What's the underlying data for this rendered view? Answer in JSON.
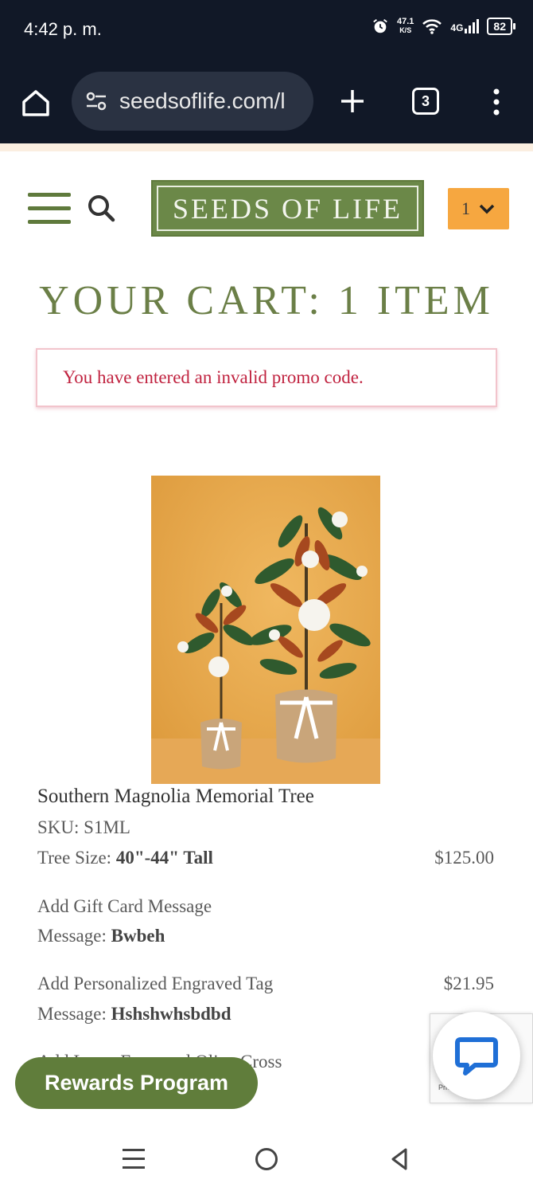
{
  "status_bar": {
    "time": "4:42 p. m.",
    "net_speed_value": "47.1",
    "net_speed_unit": "K/S",
    "network": "4G",
    "battery": "82"
  },
  "browser": {
    "url": "seedsoflife.com/l",
    "tab_count": "3",
    "icons": [
      "home-icon",
      "tune-icon",
      "plus-icon",
      "tabs-icon",
      "more-vert-icon"
    ]
  },
  "header": {
    "logo_text": "SEEDS OF LIFE",
    "cart_count": "1",
    "accent_color": "#6b8848",
    "cart_button_color": "#f6a740"
  },
  "cart": {
    "title": "YOUR CART: 1 ITEM",
    "alert": "You have entered an invalid promo code.",
    "item": {
      "name": "Southern Magnolia Memorial Tree",
      "sku_label": "SKU: ",
      "sku": "S1ML",
      "size_label": "Tree Size: ",
      "size": "40\"-44\" Tall",
      "price": "$125.00",
      "gift_card_label": "Add Gift Card Message",
      "gift_message_label": "Message: ",
      "gift_message": "Bwbeh",
      "engraved_tag_label": "Add Personalized Engraved Tag",
      "engraved_message_label": "Message: ",
      "engraved_message": "Hshshwhsbdbd",
      "engraved_tag_price": "$21.95",
      "partial_option_label": "Add Large Engraved Olive Cross"
    }
  },
  "widgets": {
    "rewards_label": "Rewards Program",
    "recaptcha_text": "Privacy - Terms"
  },
  "system_nav": [
    "recent-apps-icon",
    "home-circle-icon",
    "back-icon"
  ]
}
